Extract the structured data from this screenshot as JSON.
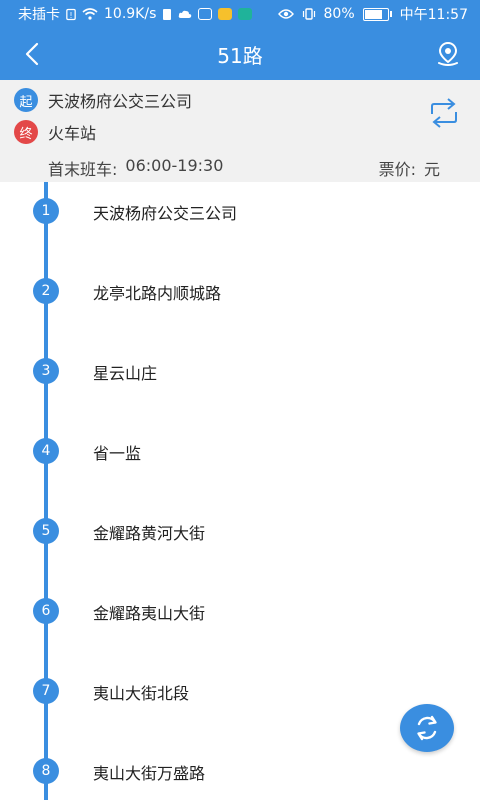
{
  "status_bar": {
    "carrier": "未插卡",
    "speed": "10.9K/s",
    "battery": "80%",
    "battery_level": 0.8,
    "time": "中午11:57"
  },
  "header": {
    "title": "51路"
  },
  "route": {
    "start_tag": "起",
    "start": "天波杨府公交三公司",
    "end_tag": "终",
    "end": "火车站",
    "hours_label": "首末班车:",
    "hours": "06:00-19:30",
    "price_label": "票价:",
    "price": "元"
  },
  "stops": [
    {
      "num": "1",
      "name": "天波杨府公交三公司"
    },
    {
      "num": "2",
      "name": "龙亭北路内顺城路"
    },
    {
      "num": "3",
      "name": "星云山庄"
    },
    {
      "num": "4",
      "name": "省一监"
    },
    {
      "num": "5",
      "name": "金耀路黄河大街"
    },
    {
      "num": "6",
      "name": "金耀路夷山大街"
    },
    {
      "num": "7",
      "name": "夷山大街北段"
    },
    {
      "num": "8",
      "name": "夷山大街万盛路"
    }
  ],
  "colors": {
    "accent": "#3a8ee0",
    "end_red": "#e34848"
  }
}
